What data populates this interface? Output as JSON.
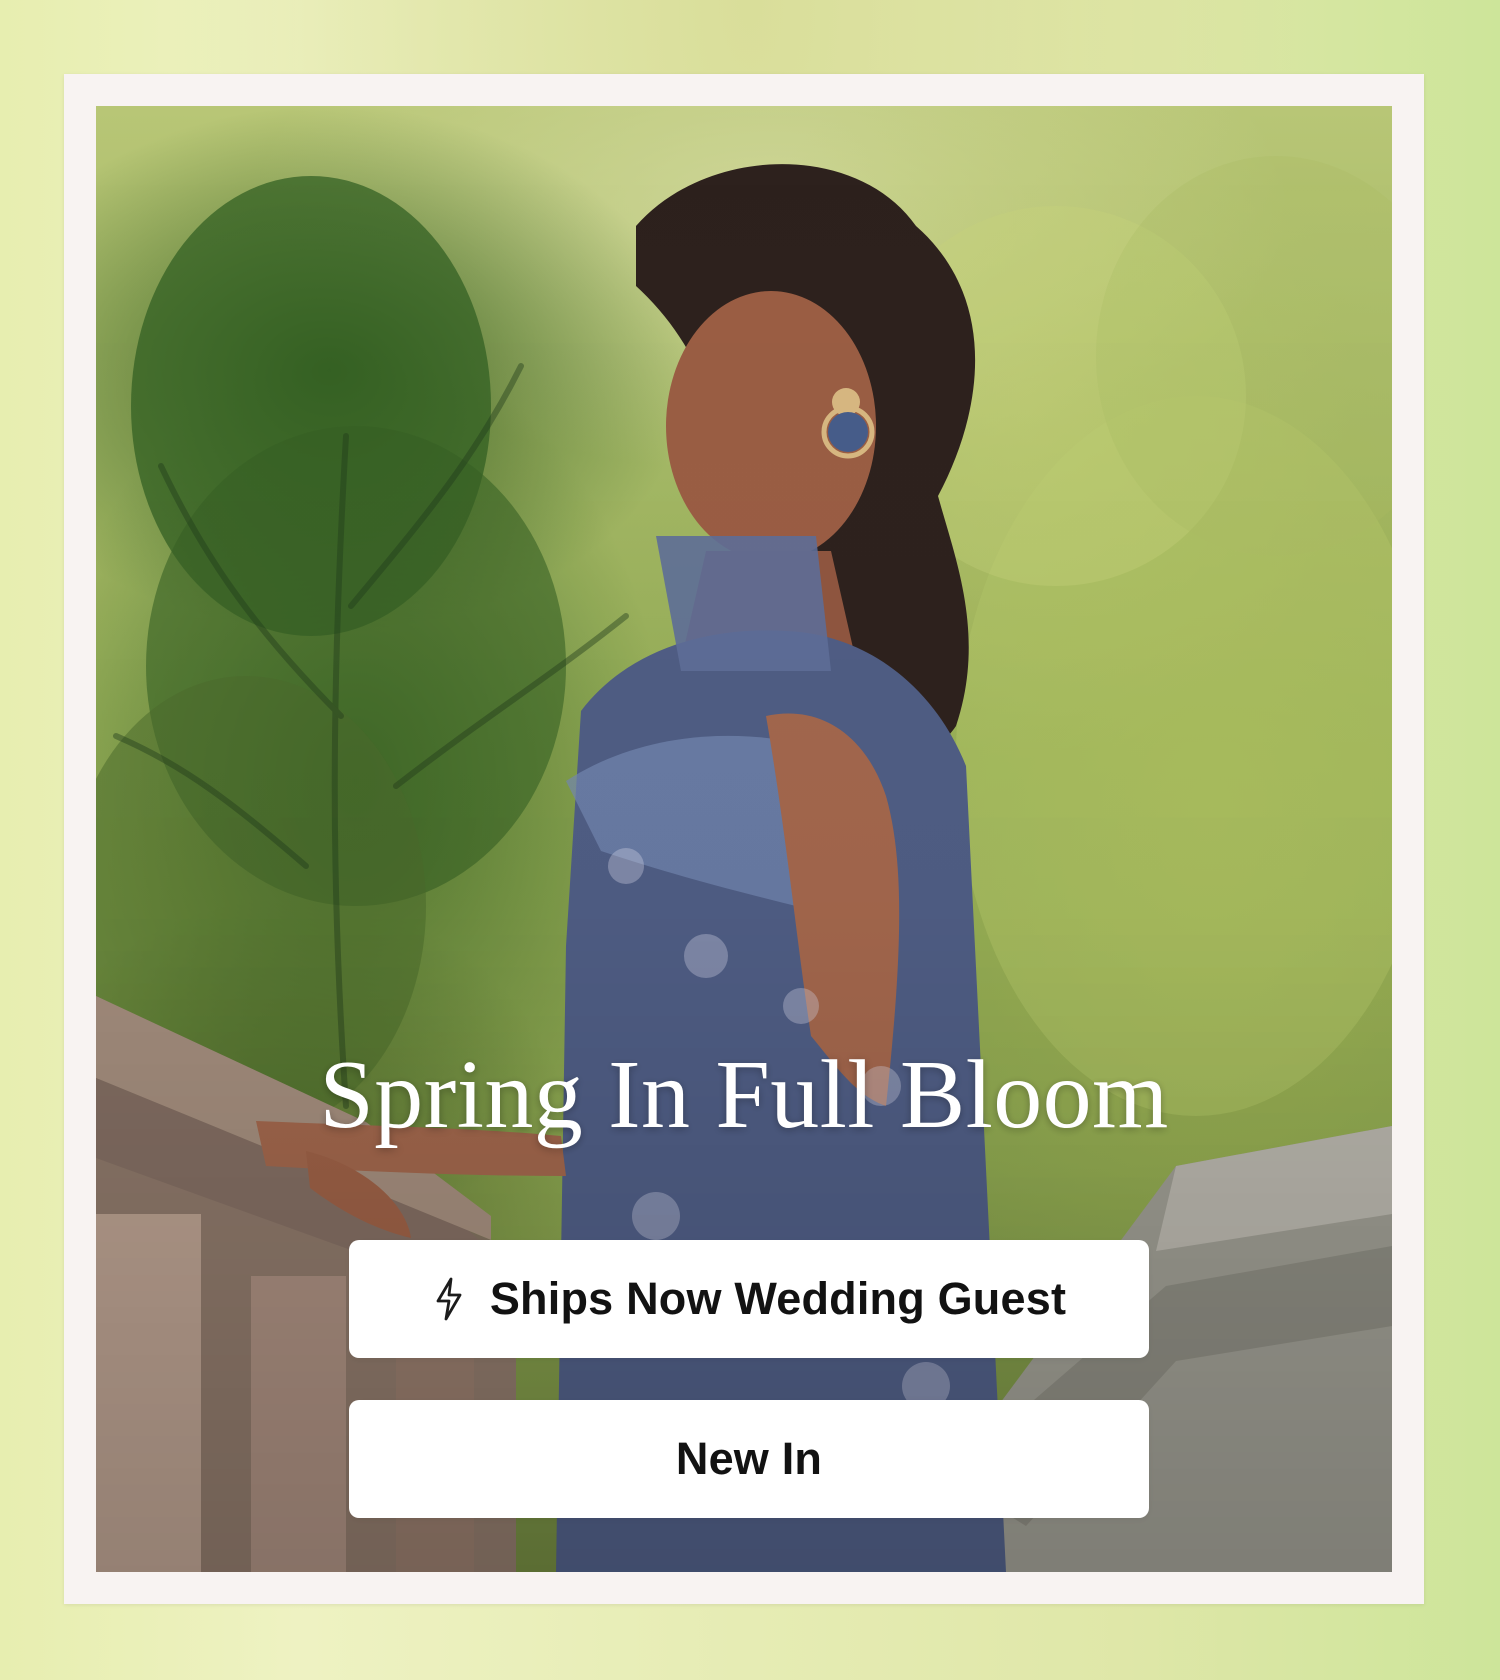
{
  "hero": {
    "headline": "Spring In Full Bloom",
    "buttons": {
      "ships_now": "Ships Now Wedding Guest",
      "new_in": "New In"
    },
    "icons": {
      "ships_now": "lightning-bolt-icon"
    },
    "colors": {
      "button_background": "#ffffff",
      "button_text": "#121212",
      "headline": "#ffffff",
      "frame": "#f8f3f2"
    }
  }
}
